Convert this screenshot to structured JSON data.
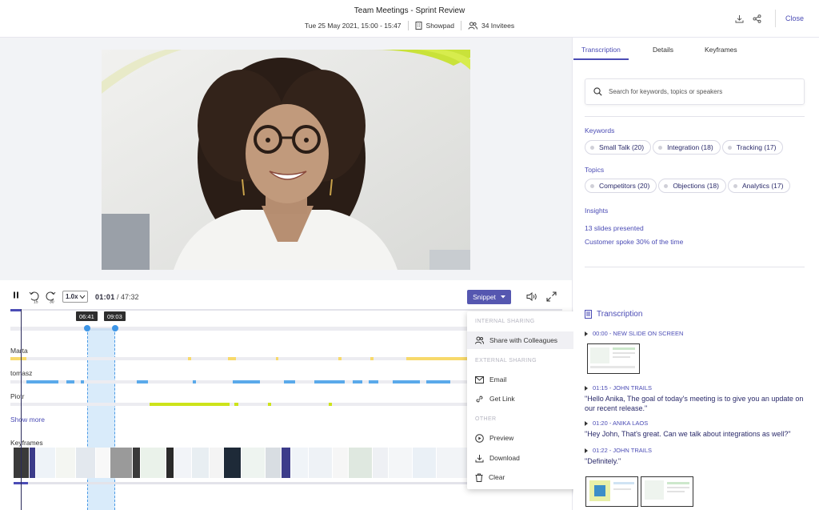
{
  "header": {
    "title": "Team Meetings - Sprint Review",
    "datetime": "Tue 25 May 2021, 15:00 - 15:47",
    "company": "Showpad",
    "invitees": "34 Invitees",
    "close_label": "Close",
    "icons": [
      "download-icon",
      "share-icon"
    ]
  },
  "player": {
    "rewind_label": "15",
    "forward_label": "30",
    "speed": "1.0x",
    "current_time": "01:01",
    "total_time": "/ 47:32",
    "snippet_label": "Snippet",
    "progress": 0.021
  },
  "timeline": {
    "selection_start": "06:41",
    "selection_end": "09:03",
    "speakers": [
      {
        "name": "Marta",
        "color": "#f7d96b"
      },
      {
        "name": "tomasz",
        "color": "#5aa9ea"
      },
      {
        "name": "Piotr",
        "color": "#cde31a"
      }
    ],
    "show_more": "Show more",
    "keyframes_label": "Keyframes"
  },
  "snippet_menu": {
    "sections": [
      {
        "title": "INTERNAL SHARING",
        "items": [
          {
            "label": "Share with Colleagues",
            "icon": "colleagues-icon"
          }
        ]
      },
      {
        "title": "EXTERNAL SHARING",
        "items": [
          {
            "label": "Email",
            "icon": "email-icon"
          },
          {
            "label": "Get Link",
            "icon": "link-icon"
          }
        ]
      },
      {
        "title": "OTHER",
        "items": [
          {
            "label": "Preview",
            "icon": "play-circle-icon"
          },
          {
            "label": "Download",
            "icon": "download-icon"
          },
          {
            "label": "Clear",
            "icon": "trash-icon"
          }
        ]
      }
    ]
  },
  "right_panel": {
    "tabs": [
      "Transcription",
      "Details",
      "Keyframes"
    ],
    "active_tab": "Transcription",
    "search_placeholder": "Search for keywords, topics or speakers",
    "keywords_title": "Keywords",
    "keywords": [
      "Small Talk (20)",
      "Integration (18)",
      "Tracking (17)"
    ],
    "topics_title": "Topics",
    "topics": [
      "Competitors (20)",
      "Objections (18)",
      "Analytics (17)"
    ],
    "insights_title": "Insights",
    "insights": [
      "13 slides presented",
      "Customer spoke 30% of the time"
    ],
    "transcription_title": "Transcription",
    "entries": [
      {
        "head": "00:00 - NEW SLIDE ON SCREEN",
        "text": ""
      },
      {
        "head": "01:15 - JOHN TRAILS",
        "text": "\"Hello Anika, The goal of today's meeting is to give you an update on our recent release.\""
      },
      {
        "head": "01:20 - ANIKA LAOS",
        "text": "\"Hey John, That's great. Can we talk about integrations as well?\""
      },
      {
        "head": "01:22 - JOHN TRAILS",
        "text": "\"Definitely.\""
      }
    ]
  },
  "colors": {
    "accent": "#4b4cb5",
    "selection": "#3d95e6"
  }
}
